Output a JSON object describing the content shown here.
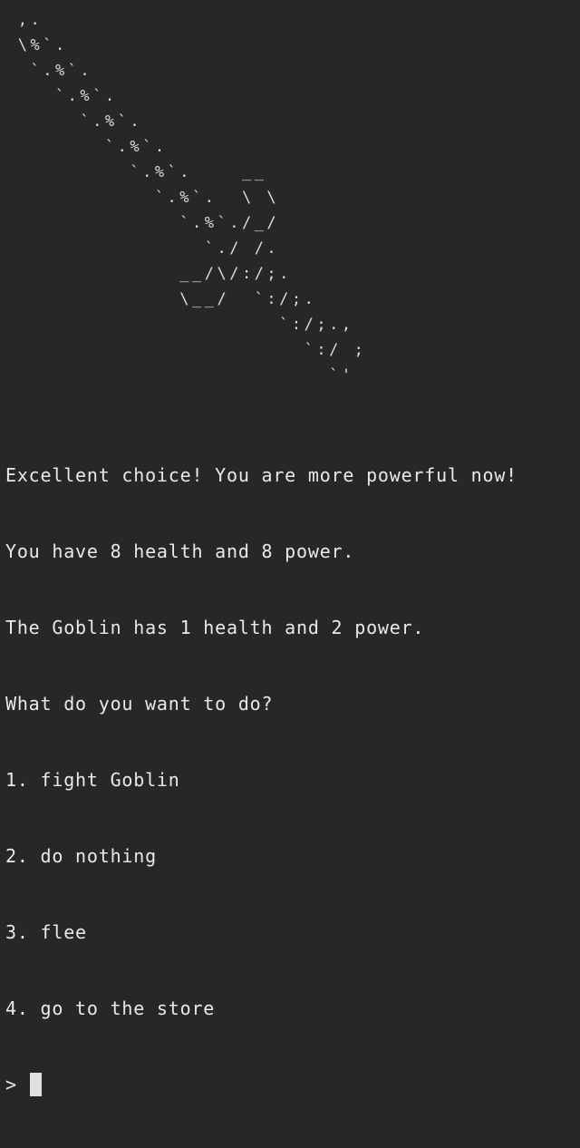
{
  "ascii_art": " ,.\n \\%`.\n  `.%`.\n    `.%`.\n      `.%`.\n        `.%`.\n          `.%`.    __\n            `.%`.  \\ \\\n              `.%`./_/\n                `./ /.\n              __/\\/:/;.\n              \\__/  `:/;.\n                      `:/;.,\n                        `:/ ;\n                          `'",
  "output_lines": [
    "Excellent choice! You are more powerful now!",
    "You have 8 health and 8 power.",
    "The Goblin has 1 health and 2 power.",
    "What do you want to do?",
    "1. fight Goblin",
    "2. do nothing",
    "3. flee",
    "4. go to the store"
  ],
  "prompt": {
    "symbol": ">",
    "input_value": ""
  },
  "colors": {
    "background": "#262729",
    "foreground": "#e9e9e9",
    "cursor": "#e0e0e0"
  }
}
